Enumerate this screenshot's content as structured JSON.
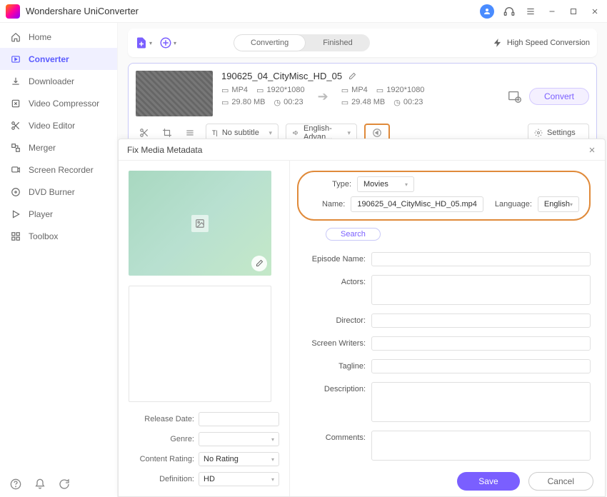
{
  "app": {
    "title": "Wondershare UniConverter"
  },
  "sidebar": {
    "items": [
      {
        "label": "Home"
      },
      {
        "label": "Converter",
        "active": true
      },
      {
        "label": "Downloader"
      },
      {
        "label": "Video Compressor"
      },
      {
        "label": "Video Editor"
      },
      {
        "label": "Merger"
      },
      {
        "label": "Screen Recorder"
      },
      {
        "label": "DVD Burner"
      },
      {
        "label": "Player"
      },
      {
        "label": "Toolbox"
      }
    ]
  },
  "toolbar": {
    "tabs": {
      "converting": "Converting",
      "finished": "Finished"
    },
    "high_speed": "High Speed Conversion"
  },
  "item": {
    "title": "190625_04_CityMisc_HD_05",
    "src": {
      "format": "MP4",
      "res": "1920*1080",
      "size": "29.80 MB",
      "dur": "00:23"
    },
    "dst": {
      "format": "MP4",
      "res": "1920*1080",
      "size": "29.48 MB",
      "dur": "00:23"
    },
    "subtitle": "No subtitle",
    "audio": "English-Advan...",
    "settings": "Settings",
    "convert": "Convert"
  },
  "modal": {
    "title": "Fix Media Metadata",
    "type_label": "Type:",
    "type_value": "Movies",
    "name_label": "Name:",
    "name_value": "190625_04_CityMisc_HD_05.mp4",
    "lang_label": "Language:",
    "lang_value": "English",
    "search": "Search",
    "fields": {
      "episode": "Episode Name:",
      "actors": "Actors:",
      "director": "Director:",
      "writers": "Screen Writers:",
      "tagline": "Tagline:",
      "description": "Description:",
      "comments": "Comments:"
    },
    "left_fields": {
      "release": "Release Date:",
      "genre": "Genre:",
      "rating": "Content Rating:",
      "rating_value": "No Rating",
      "definition": "Definition:",
      "definition_value": "HD"
    },
    "save": "Save",
    "cancel": "Cancel"
  }
}
